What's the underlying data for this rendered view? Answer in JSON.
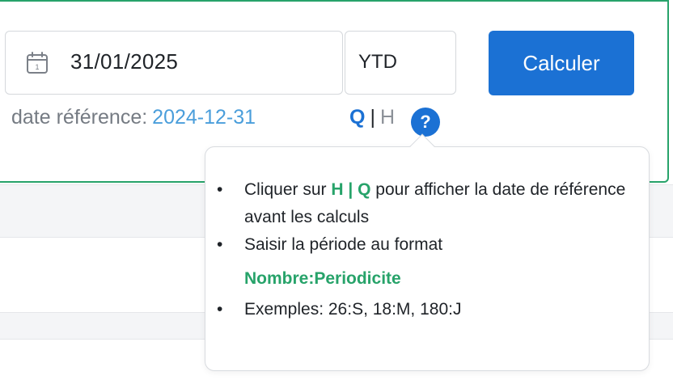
{
  "date_field": {
    "value": "31/01/2025",
    "icon": "calendar-icon"
  },
  "period_field": {
    "value": "YTD"
  },
  "calculate_button": {
    "label": "Calculer",
    "color": "#1b71d4"
  },
  "reference": {
    "label": "date référence:",
    "date": "2024-12-31"
  },
  "period_toggle": {
    "q": "Q",
    "separator": "|",
    "h": "H"
  },
  "help": {
    "icon": "question-circle-icon",
    "glyph": "?"
  },
  "tooltip": {
    "item1_before": "Cliquer sur",
    "item1_hq": "H | Q",
    "item1_after": "pour afficher la date de référence avant les calculs",
    "item2": "Saisir la période au format",
    "item2_format": "Nombre:Periodicite",
    "item3": "Exemples: 26:S, 18:M, 180:J"
  },
  "colors": {
    "accent": "#1b71d4",
    "green": "#27a36a",
    "link": "#4a9edb"
  }
}
